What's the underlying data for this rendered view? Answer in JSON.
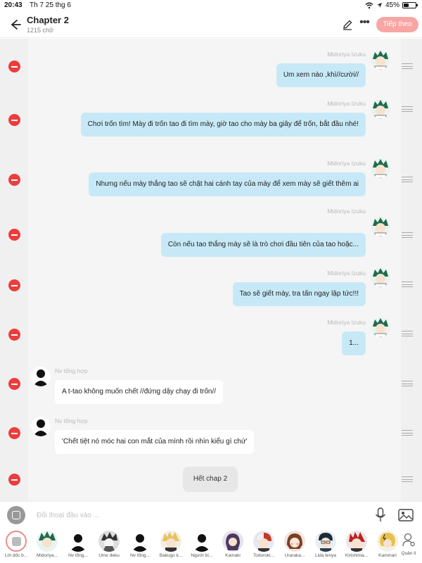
{
  "status_bar": {
    "time": "20:43",
    "date": "Th 7 25 thg 6",
    "battery": "45%",
    "battery_level": 0.45
  },
  "header": {
    "title": "Chapter 2",
    "word_count": "1215 chữ",
    "follow_label": "Tiếp theo"
  },
  "messages": [
    {
      "side": "right",
      "sender": "Midoriya Izuku",
      "text": "Um xem nào ,khì//cười//"
    },
    {
      "side": "right",
      "sender": "Midoriya Izuku",
      "text": "Chơi trốn tìm! Mày đi trốn tao đi tìm mày, giờ tao cho mày ba giây để trốn, bắt đầu nhé!"
    },
    {
      "side": "right",
      "sender": "Midoriya Izuku",
      "text": "Nhưng nếu mày thắng tao sẽ chặt hai cánh tay của mày để xem mày sẽ giết thêm ai"
    },
    {
      "side": "right",
      "sender": "Midoriya Izuku",
      "text": "Còn nếu tao thắng mày sẽ là trò chơi đầu tiên của tao hoặc..."
    },
    {
      "side": "right",
      "sender": "Midoriya Izuku",
      "text": "Tao sẽ giết mày, tra tấn ngay lập tức!!!"
    },
    {
      "side": "right",
      "sender": "Midoriya Izuku",
      "text": "1..."
    },
    {
      "side": "left",
      "sender": "Nv tổng hợp",
      "text": "A t-tao không muốn chết //đứng dậy chạy đi trốn//"
    },
    {
      "side": "left",
      "sender": "Nv tổng hợp",
      "text": "'Chết tiệt nó móc hai con mắt của mình rồi nhìn kiểu gì chứ'"
    }
  ],
  "end_message": "Hết chap 2",
  "input": {
    "placeholder": "Đối thoại đầu vào ..."
  },
  "characters": [
    {
      "label": "Lời dốc b...",
      "selected": true
    },
    {
      "label": "Midoriya..."
    },
    {
      "label": "Nv tổng..."
    },
    {
      "label": "Ume deku"
    },
    {
      "label": "Nv tổng..."
    },
    {
      "label": "Bakugo k..."
    },
    {
      "label": "Người bí..."
    },
    {
      "label": "Kamaki"
    },
    {
      "label": "Todoroki..."
    },
    {
      "label": "Uraraka..."
    },
    {
      "label": "Lida tenya"
    },
    {
      "label": "Kirishima..."
    },
    {
      "label": "Kaminari"
    }
  ],
  "manage_label": "Quản lí",
  "colors": {
    "accent": "#f8a5a4",
    "bubble_right": "#c7e9f7",
    "delete": "#ec3d3d"
  }
}
